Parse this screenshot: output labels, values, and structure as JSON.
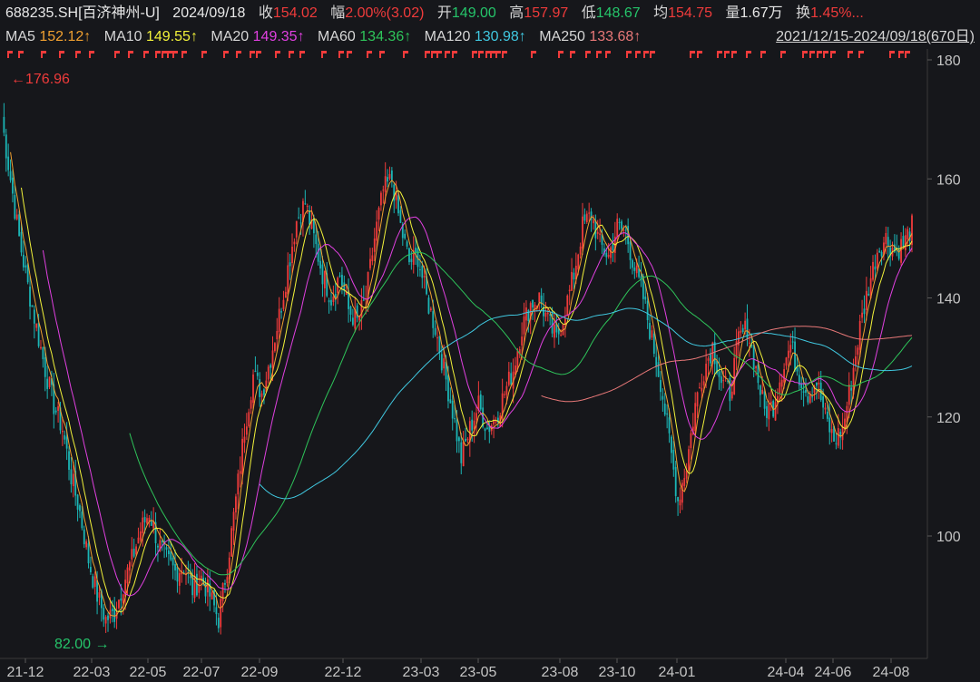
{
  "header": {
    "code": "688235.SH[百济神州-U]",
    "date": "2024/09/18",
    "close_label": "收",
    "close_value": "154.02",
    "change_label": "幅",
    "change_value": "2.00%(3.02)",
    "open_label": "开",
    "open_value": "149.00",
    "high_label": "高",
    "high_value": "157.97",
    "low_label": "低",
    "low_value": "148.67",
    "avg_label": "均",
    "avg_value": "154.75",
    "volume_label": "量",
    "volume_value": "1.67万",
    "turnover_label": "换",
    "turnover_value": "1.45%..."
  },
  "ma_row": {
    "items": [
      {
        "label": "MA5",
        "value": "152.12↑",
        "color": "#f0a030"
      },
      {
        "label": "MA10",
        "value": "149.55↑",
        "color": "#f2f23a"
      },
      {
        "label": "MA20",
        "value": "149.35↑",
        "color": "#e040e0"
      },
      {
        "label": "MA60",
        "value": "134.36↑",
        "color": "#2ec45a"
      },
      {
        "label": "MA120",
        "value": "130.98↑",
        "color": "#40c8e0"
      },
      {
        "label": "MA250",
        "value": "133.68↑",
        "color": "#e87878"
      }
    ],
    "date_range": "2021/12/15-2024/09/18(670日)"
  },
  "chart_data": {
    "type": "candlestick",
    "ylim": [
      80,
      182
    ],
    "y_ticks": [
      "180",
      "160",
      "140",
      "120",
      "100"
    ],
    "x_ticks": [
      "21-12",
      "22-03",
      "22-05",
      "22-07",
      "22-09",
      "22-12",
      "23-03",
      "23-05",
      "23-08",
      "23-10",
      "24-01",
      "24-04",
      "24-06",
      "24-08"
    ],
    "annotations": {
      "max_label": "176.96",
      "min_label": "82.00"
    },
    "colors": {
      "up": "#ef3b3b",
      "down": "#1bb5b5",
      "ma5": "#f0a030",
      "ma10": "#f2f23a",
      "ma20": "#e040e0",
      "ma60": "#2ec45a",
      "ma120": "#40c8e0",
      "ma250": "#e87878"
    },
    "close_path": [
      [
        0,
        170
      ],
      [
        4,
        160
      ],
      [
        8,
        150
      ],
      [
        12,
        142
      ],
      [
        16,
        135
      ],
      [
        20,
        128
      ],
      [
        24,
        122
      ],
      [
        28,
        118
      ],
      [
        32,
        110
      ],
      [
        36,
        104
      ],
      [
        40,
        96
      ],
      [
        44,
        90
      ],
      [
        48,
        86
      ],
      [
        52,
        87
      ],
      [
        56,
        92
      ],
      [
        60,
        96
      ],
      [
        64,
        101
      ],
      [
        68,
        104
      ],
      [
        72,
        99
      ],
      [
        76,
        96
      ],
      [
        80,
        94
      ],
      [
        84,
        95
      ],
      [
        88,
        91
      ],
      [
        92,
        93
      ],
      [
        96,
        90
      ],
      [
        100,
        86
      ],
      [
        104,
        95
      ],
      [
        108,
        106
      ],
      [
        112,
        118
      ],
      [
        116,
        127
      ],
      [
        120,
        124
      ],
      [
        124,
        130
      ],
      [
        128,
        137
      ],
      [
        132,
        145
      ],
      [
        136,
        153
      ],
      [
        140,
        156
      ],
      [
        144,
        150
      ],
      [
        148,
        144
      ],
      [
        152,
        140
      ],
      [
        156,
        144
      ],
      [
        160,
        138
      ],
      [
        164,
        136
      ],
      [
        168,
        140
      ],
      [
        172,
        150
      ],
      [
        176,
        158
      ],
      [
        180,
        160
      ],
      [
        184,
        152
      ],
      [
        188,
        146
      ],
      [
        192,
        147
      ],
      [
        196,
        140
      ],
      [
        200,
        135
      ],
      [
        204,
        128
      ],
      [
        208,
        121
      ],
      [
        212,
        113
      ],
      [
        216,
        118
      ],
      [
        220,
        122
      ],
      [
        224,
        118
      ],
      [
        228,
        120
      ],
      [
        232,
        124
      ],
      [
        236,
        128
      ],
      [
        240,
        135
      ],
      [
        244,
        139
      ],
      [
        248,
        140
      ],
      [
        252,
        136
      ],
      [
        256,
        133
      ],
      [
        260,
        138
      ],
      [
        264,
        144
      ],
      [
        268,
        152
      ],
      [
        272,
        154
      ],
      [
        276,
        149
      ],
      [
        280,
        147
      ],
      [
        284,
        152
      ],
      [
        288,
        151
      ],
      [
        292,
        145
      ],
      [
        296,
        140
      ],
      [
        300,
        133
      ],
      [
        304,
        126
      ],
      [
        308,
        116
      ],
      [
        312,
        106
      ],
      [
        316,
        112
      ],
      [
        320,
        122
      ],
      [
        324,
        128
      ],
      [
        328,
        132
      ],
      [
        332,
        126
      ],
      [
        336,
        124
      ],
      [
        340,
        133
      ],
      [
        344,
        135
      ],
      [
        348,
        128
      ],
      [
        352,
        121
      ],
      [
        356,
        122
      ],
      [
        360,
        128
      ],
      [
        364,
        132
      ],
      [
        368,
        127
      ],
      [
        372,
        124
      ],
      [
        376,
        126
      ],
      [
        380,
        120
      ],
      [
        384,
        116
      ],
      [
        388,
        118
      ],
      [
        392,
        126
      ],
      [
        396,
        135
      ],
      [
        400,
        142
      ],
      [
        404,
        148
      ],
      [
        408,
        150
      ],
      [
        412,
        148
      ],
      [
        416,
        149
      ],
      [
        420,
        152
      ]
    ]
  }
}
